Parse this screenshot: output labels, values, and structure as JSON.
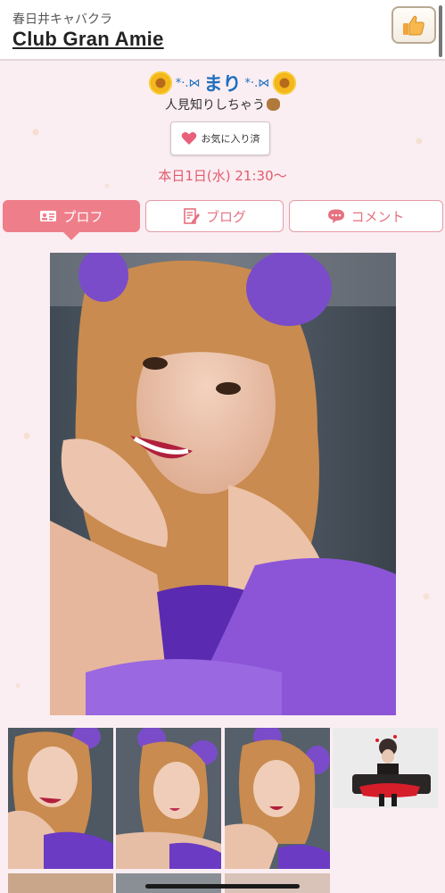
{
  "header": {
    "subtitle": "春日井キャバクラ",
    "title": "Club Gran Amie"
  },
  "profile": {
    "name": "まり",
    "name_deco_left": "*·.⋈",
    "name_deco_right": "*·.⋈",
    "tagline": "人見知りしちゃう",
    "favorite_label": "お気に入り済",
    "schedule": "本日1日(水) 21:30〜"
  },
  "tabs": [
    {
      "label": "プロフ",
      "icon": "profile-card-icon",
      "active": true
    },
    {
      "label": "ブログ",
      "icon": "blog-edit-icon",
      "active": false
    },
    {
      "label": "コメント",
      "icon": "comment-bubble-icon",
      "active": false
    }
  ],
  "colors": {
    "accent": "#ef7e8b",
    "accent_text": "#e5717f",
    "schedule": "#e25a6d",
    "name": "#1f6fbf",
    "background": "#fbeef2"
  },
  "photos": {
    "main": "portrait-photo",
    "thumbnails": [
      "thumbnail-photo-1",
      "thumbnail-photo-2",
      "thumbnail-photo-3",
      "thumbnail-photo-4"
    ]
  }
}
